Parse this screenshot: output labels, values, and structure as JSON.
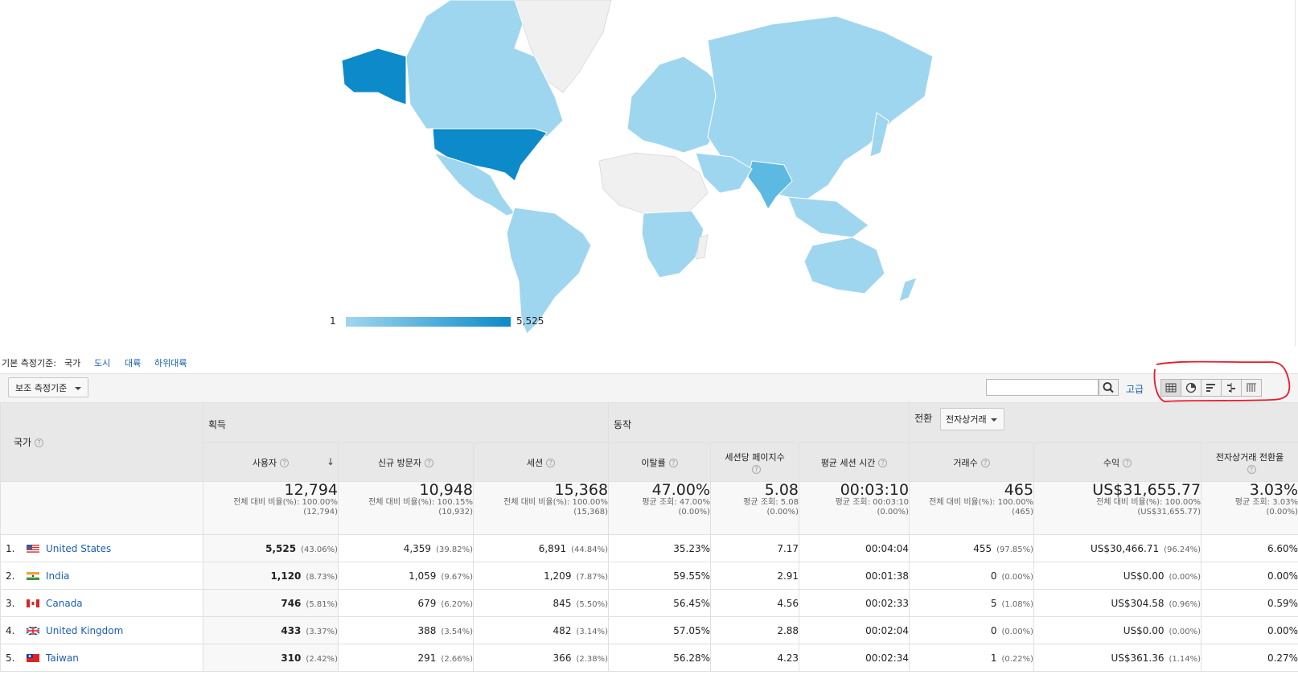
{
  "legend": {
    "min": "1",
    "max": "5,525"
  },
  "dimension": {
    "label": "기본 측정기준:",
    "active": "국가",
    "links": [
      "도시",
      "대륙",
      "하위대륙"
    ]
  },
  "toolbar": {
    "secondary_dimension": "보조 측정기준",
    "advanced_link": "고급",
    "view_icons": [
      "table-view-icon",
      "pie-view-icon",
      "performance-view-icon",
      "comparison-view-icon",
      "pivot-view-icon"
    ]
  },
  "table": {
    "country_header": "국가",
    "groups": {
      "acquisition": "획득",
      "behavior": "동작",
      "conversion": "전환",
      "conversion_select": "전자상거래"
    },
    "columns": [
      "사용자",
      "신규 방문자",
      "세션",
      "이탈률",
      "세션당 페이지수",
      "평균 세션 시간",
      "거래수",
      "수익",
      "전자상거래 전환율"
    ],
    "totals": [
      {
        "big": "12,794",
        "sub1": "전체 대비 비율(%): 100.00%",
        "sub2": "(12,794)"
      },
      {
        "big": "10,948",
        "sub1": "전체 대비 비율(%): 100.15%",
        "sub2": "(10,932)"
      },
      {
        "big": "15,368",
        "sub1": "전체 대비 비율(%): 100.00%",
        "sub2": "(15,368)"
      },
      {
        "big": "47.00%",
        "sub1": "평균 조회: 47.00%",
        "sub2": "(0.00%)"
      },
      {
        "big": "5.08",
        "sub1": "평균 조회: 5.08",
        "sub2": "(0.00%)"
      },
      {
        "big": "00:03:10",
        "sub1": "평균 조회: 00:03:10",
        "sub2": "(0.00%)"
      },
      {
        "big": "465",
        "sub1": "전체 대비 비율(%): 100.00%",
        "sub2": "(465)"
      },
      {
        "big": "US$31,655.77",
        "sub1": "전체 대비 비율(%): 100.00%",
        "sub2": "(US$31,655.77)"
      },
      {
        "big": "3.03%",
        "sub1": "평균 조회: 3.03%",
        "sub2": "(0.00%)"
      }
    ],
    "rows": [
      {
        "idx": "1.",
        "country": "United States",
        "users": "5,525",
        "users_pct": "(43.06%)",
        "new": "4,359",
        "new_pct": "(39.82%)",
        "sessions": "6,891",
        "sessions_pct": "(44.84%)",
        "bounce": "35.23%",
        "pps": "7.17",
        "dur": "00:04:04",
        "tx": "455",
        "tx_pct": "(97.85%)",
        "rev": "US$30,466.71",
        "rev_pct": "(96.24%)",
        "conv": "6.60%"
      },
      {
        "idx": "2.",
        "country": "India",
        "users": "1,120",
        "users_pct": "(8.73%)",
        "new": "1,059",
        "new_pct": "(9.67%)",
        "sessions": "1,209",
        "sessions_pct": "(7.87%)",
        "bounce": "59.55%",
        "pps": "2.91",
        "dur": "00:01:38",
        "tx": "0",
        "tx_pct": "(0.00%)",
        "rev": "US$0.00",
        "rev_pct": "(0.00%)",
        "conv": "0.00%"
      },
      {
        "idx": "3.",
        "country": "Canada",
        "users": "746",
        "users_pct": "(5.81%)",
        "new": "679",
        "new_pct": "(6.20%)",
        "sessions": "845",
        "sessions_pct": "(5.50%)",
        "bounce": "56.45%",
        "pps": "4.56",
        "dur": "00:02:33",
        "tx": "5",
        "tx_pct": "(1.08%)",
        "rev": "US$304.58",
        "rev_pct": "(0.96%)",
        "conv": "0.59%"
      },
      {
        "idx": "4.",
        "country": "United Kingdom",
        "users": "433",
        "users_pct": "(3.37%)",
        "new": "388",
        "new_pct": "(3.54%)",
        "sessions": "482",
        "sessions_pct": "(3.14%)",
        "bounce": "57.05%",
        "pps": "2.88",
        "dur": "00:02:04",
        "tx": "0",
        "tx_pct": "(0.00%)",
        "rev": "US$0.00",
        "rev_pct": "(0.00%)",
        "conv": "0.00%"
      },
      {
        "idx": "5.",
        "country": "Taiwan",
        "users": "310",
        "users_pct": "(2.42%)",
        "new": "291",
        "new_pct": "(2.66%)",
        "sessions": "366",
        "sessions_pct": "(2.38%)",
        "bounce": "56.28%",
        "pps": "4.23",
        "dur": "00:02:34",
        "tx": "1",
        "tx_pct": "(0.22%)",
        "rev": "US$361.36",
        "rev_pct": "(1.14%)",
        "conv": "0.27%"
      }
    ]
  },
  "colors": {
    "map_dark": "#0d8ac9",
    "map_mid": "#5bb9e2",
    "map_light": "#9fd6ef",
    "map_none": "#f0f0f0",
    "link": "#1a5fb4",
    "annotation": "#e8192c"
  }
}
